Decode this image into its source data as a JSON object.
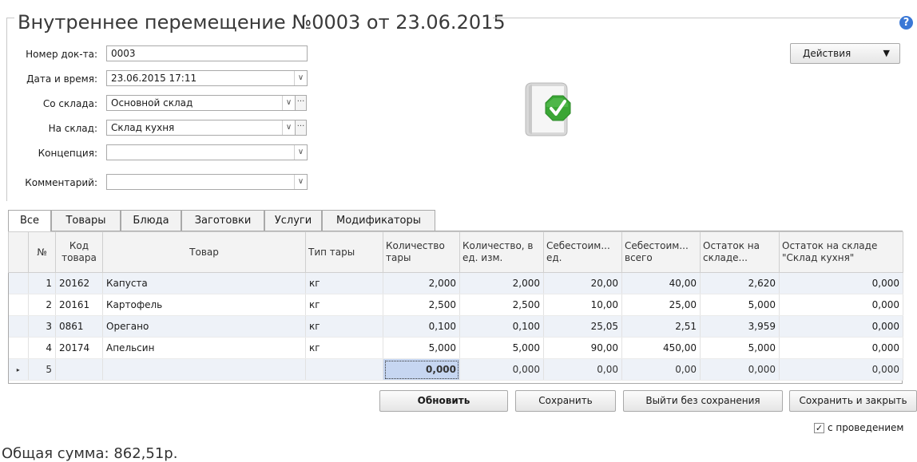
{
  "title": "Внутреннее перемещение №0003 от 23.06.2015",
  "help_icon": "?",
  "form": {
    "doc_number_label": "Номер док-та:",
    "doc_number_value": "0003",
    "datetime_label": "Дата и время:",
    "datetime_value": "23.06.2015 17:11",
    "from_label": "Со склада:",
    "from_value": "Основной склад",
    "to_label": "На склад:",
    "to_value": "Склад кухня",
    "concept_label": "Концепция:",
    "concept_value": "",
    "comment_label": "Комментарий:",
    "comment_value": "",
    "combo_arrow": "∨",
    "ellipsis": "···"
  },
  "actions": {
    "label": "Действия",
    "arrow": "▼"
  },
  "tabs": [
    "Все",
    "Товары",
    "Блюда",
    "Заготовки",
    "Услуги",
    "Модификаторы"
  ],
  "table": {
    "columns": [
      "№",
      "Код товара",
      "Товар",
      "Тип тары",
      "Количество тары",
      "Количество, в ед. изм.",
      "Себестоим... ед.",
      "Себестоим... всего",
      "Остаток на складе...",
      "Остаток на складе \"Склад кухня\""
    ],
    "rows": [
      {
        "n": "1",
        "code": "20162",
        "name": "Капуста",
        "pack": "кг",
        "qty_pack": "2,000",
        "qty_unit": "2,000",
        "cost_unit": "20,00",
        "cost_total": "40,00",
        "stock": "2,620",
        "stock_kitchen": "0,000"
      },
      {
        "n": "2",
        "code": "20161",
        "name": "Картофель",
        "pack": "кг",
        "qty_pack": "2,500",
        "qty_unit": "2,500",
        "cost_unit": "10,00",
        "cost_total": "25,00",
        "stock": "5,000",
        "stock_kitchen": "0,000"
      },
      {
        "n": "3",
        "code": "0861",
        "name": "Орегано",
        "pack": "кг",
        "qty_pack": "0,100",
        "qty_unit": "0,100",
        "cost_unit": "25,05",
        "cost_total": "2,51",
        "stock": "3,959",
        "stock_kitchen": "0,000"
      },
      {
        "n": "4",
        "code": "20174",
        "name": "Апельсин",
        "pack": "кг",
        "qty_pack": "5,000",
        "qty_unit": "5,000",
        "cost_unit": "90,00",
        "cost_total": "450,00",
        "stock": "5,000",
        "stock_kitchen": "0,000"
      },
      {
        "n": "5",
        "code": "",
        "name": "",
        "pack": "",
        "qty_pack": "0,000",
        "qty_unit": "0,000",
        "cost_unit": "0,00",
        "cost_total": "0,00",
        "stock": "0,000",
        "stock_kitchen": "0,000"
      }
    ],
    "row_marker": "▸"
  },
  "buttons": {
    "refresh": "Обновить",
    "save": "Сохранить",
    "exit_no_save": "Выйти без сохранения",
    "save_close": "Сохранить и закрыть"
  },
  "post_checkbox": {
    "label": "с проведением",
    "checked": true,
    "mark": "✓"
  },
  "total": "Общая сумма: 862,51р.",
  "colors": {
    "accent_green": "#3aa635",
    "help_blue": "#3a78d6",
    "selected_cell": "#c6d6f1"
  }
}
